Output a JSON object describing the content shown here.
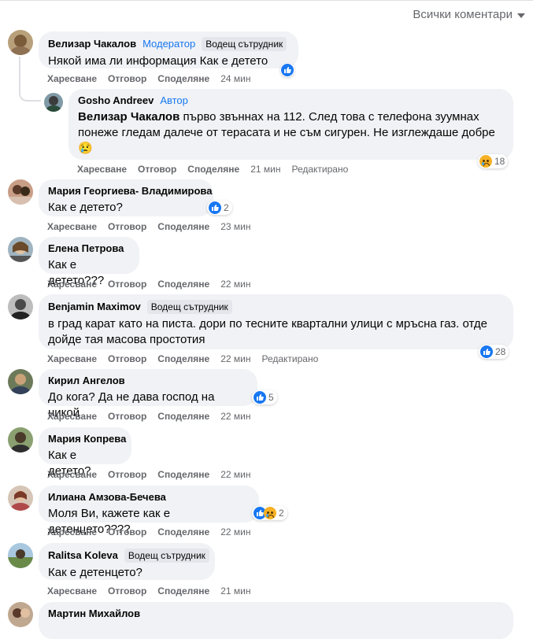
{
  "filter_label": "Всички коментари",
  "comments": [
    {
      "name": "Велизар Чакалов",
      "role": "Модератор",
      "badge": "Водещ сътрудник",
      "text": "Някой има ли информация Как е детето",
      "like": "Харесване",
      "reply": "Отговор",
      "share": "Споделяне",
      "time": "24 мин"
    },
    {
      "name": "Gosho Andreev",
      "role": "Автор",
      "mention": "Велизар Чакалов",
      "text": " първо звъннах на 112. След това с телефона зуумнах понеже гледам далече от терасата и не съм сигурен. Не изглеждаше добре 😢",
      "like": "Харесване",
      "reply": "Отговор",
      "share": "Споделяне",
      "time": "21 мин",
      "edited": "Редактирано",
      "reactions": "18"
    },
    {
      "name": "Мария Георгиева- Владимирова",
      "text": "Как е детето?",
      "like": "Харесване",
      "reply": "Отговор",
      "share": "Споделяне",
      "time": "23 мин",
      "reactions": "2"
    },
    {
      "name": "Елена Петрова",
      "text": "Как е детето???",
      "like": "Харесване",
      "reply": "Отговор",
      "share": "Споделяне",
      "time": "22 мин"
    },
    {
      "name": "Benjamin Maximov",
      "badge": "Водещ сътрудник",
      "text": "в град карат като на писта. дори по тесните квартални улици с мръсна газ. отде дойде тая масова простотия",
      "like": "Харесване",
      "reply": "Отговор",
      "share": "Споделяне",
      "time": "22 мин",
      "edited": "Редактирано",
      "reactions": "28"
    },
    {
      "name": "Кирил Ангелов",
      "text": "До кога? Да не дава господ на никой",
      "like": "Харесване",
      "reply": "Отговор",
      "share": "Споделяне",
      "time": "22 мин",
      "reactions": "5"
    },
    {
      "name": "Мария Копрева",
      "text": "Как е детето?",
      "like": "Харесване",
      "reply": "Отговор",
      "share": "Споделяне",
      "time": "22 мин"
    },
    {
      "name": "Илиана Амзова-Бечева",
      "text": "Моля Ви, кажете как е детенцето????",
      "like": "Харесване",
      "reply": "Отговор",
      "share": "Споделяне",
      "time": "22 мин",
      "reactions": "2"
    },
    {
      "name": "Ralitsa Koleva",
      "badge": "Водещ сътрудник",
      "text": "Как е детенцето?",
      "like": "Харесване",
      "reply": "Отговор",
      "share": "Споделяне",
      "time": "21 мин"
    },
    {
      "name": "Мартин Михайлов"
    }
  ],
  "colors": {
    "accent": "#1877f2",
    "bubble": "#f0f2f5",
    "muted": "#65676b"
  }
}
